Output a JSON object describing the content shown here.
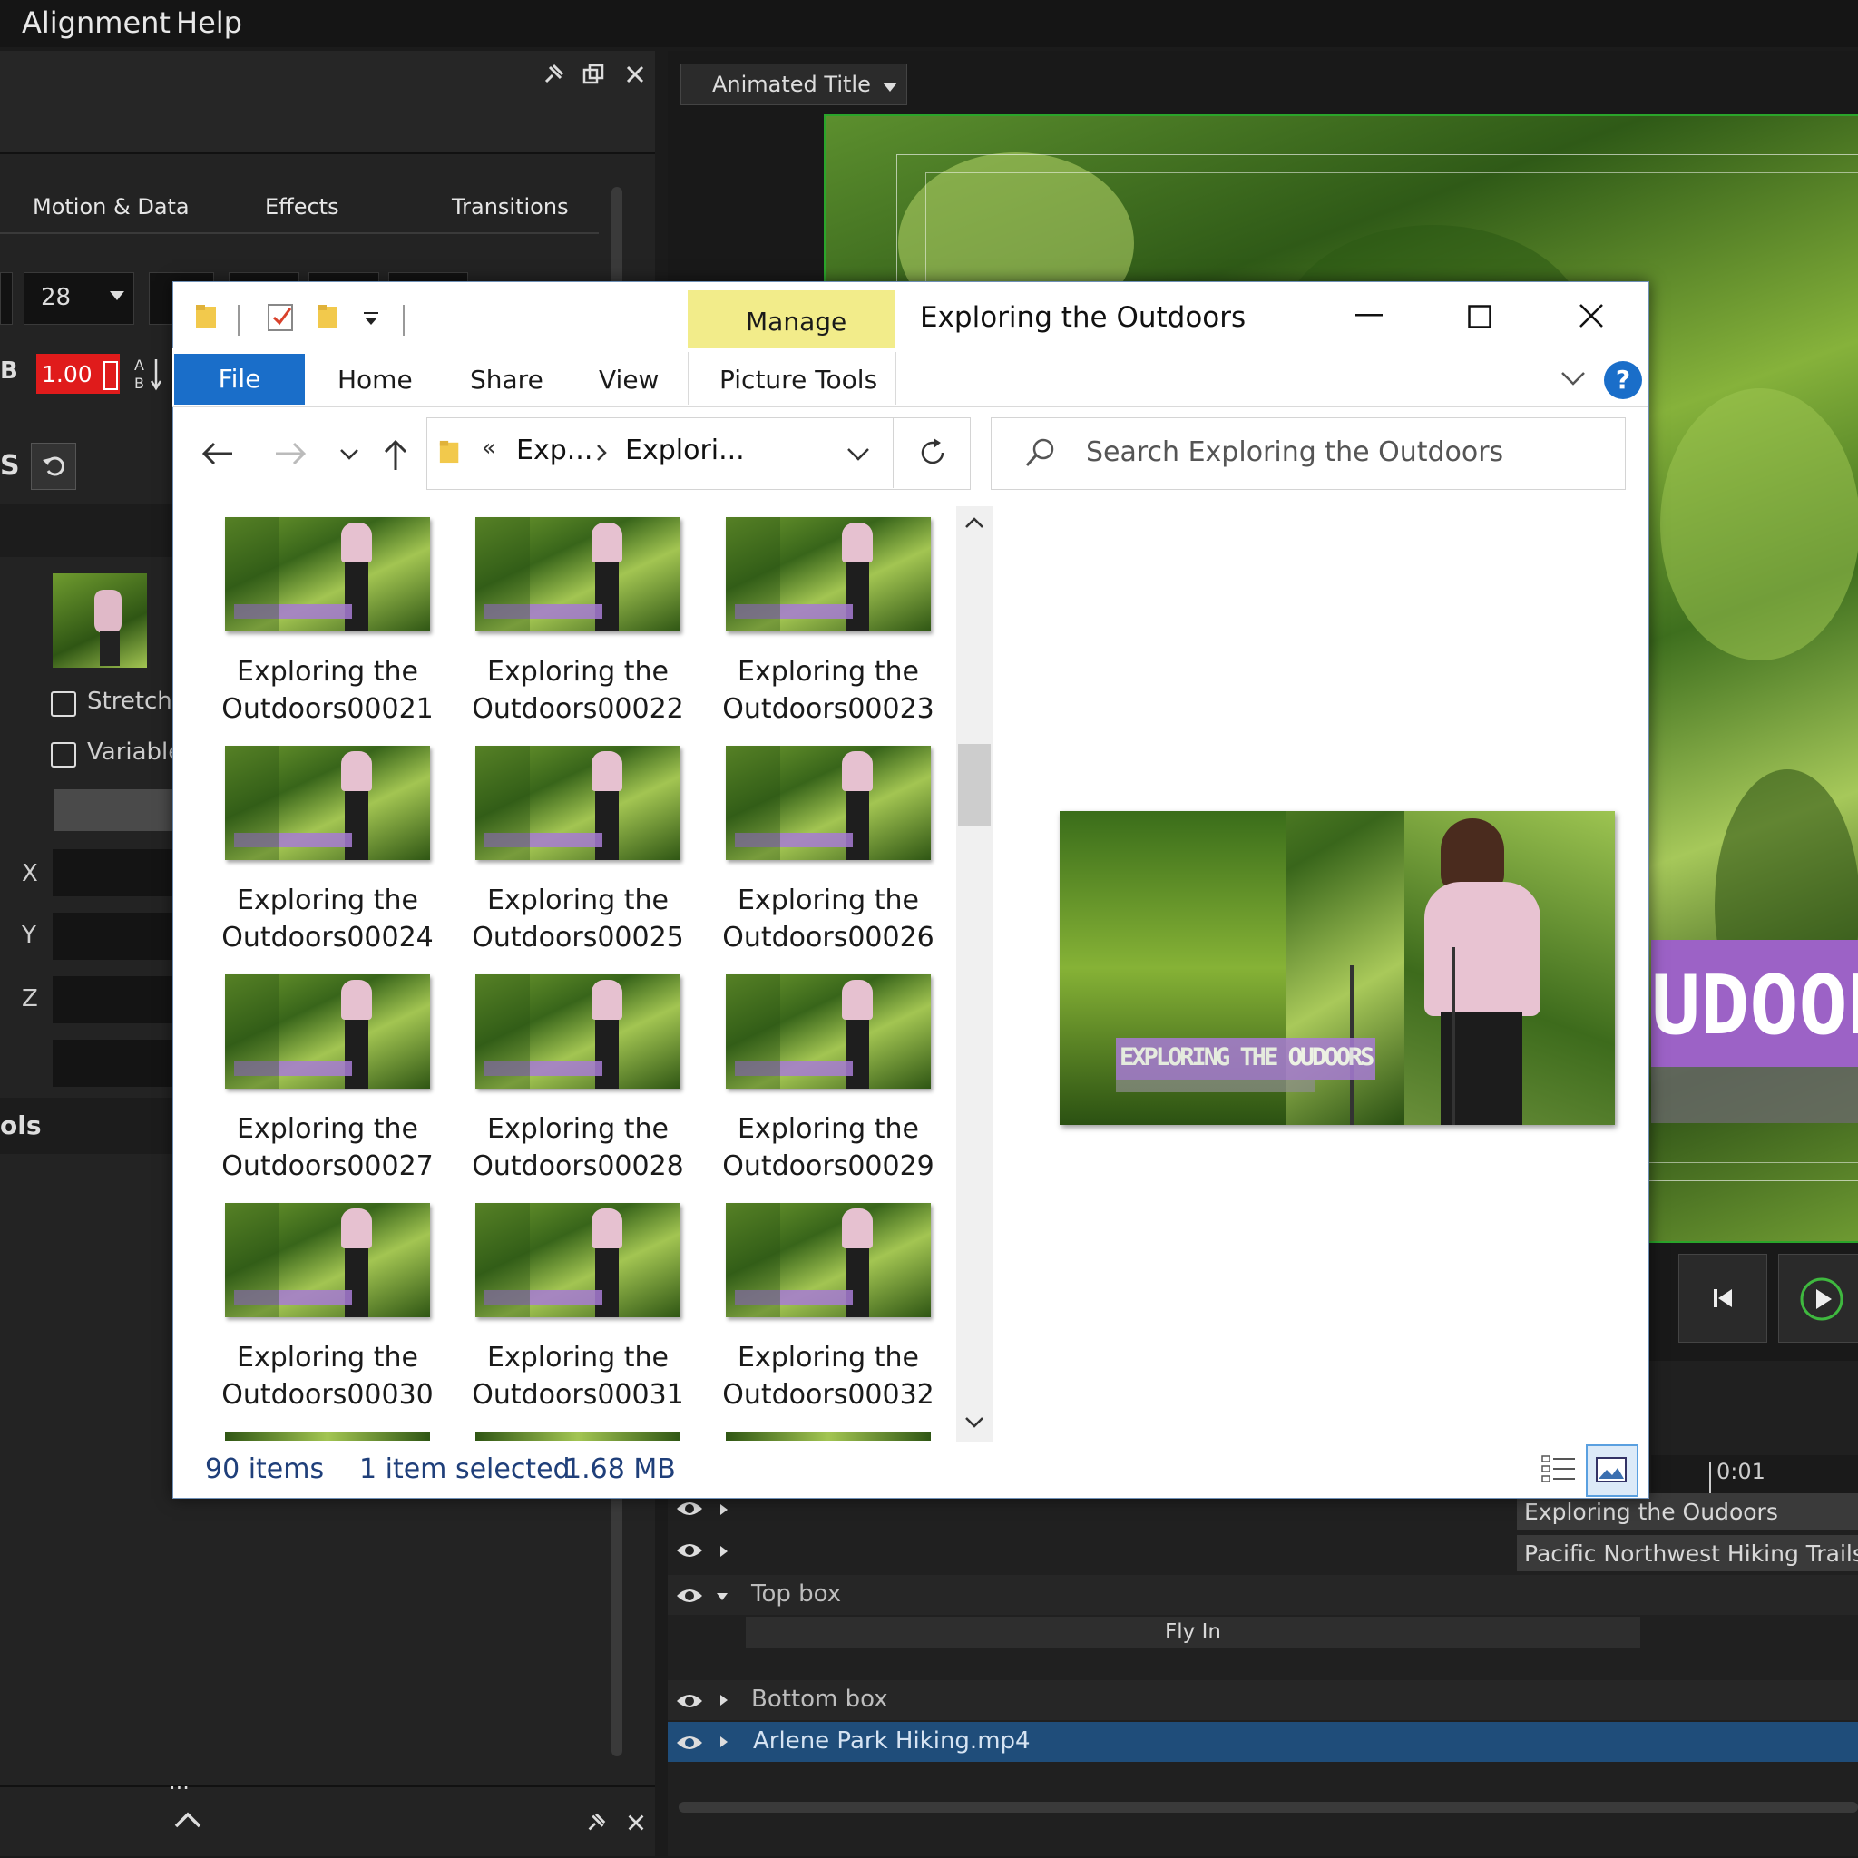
{
  "menubar": {
    "items": [
      "Alignment",
      "Help"
    ]
  },
  "left_panel": {
    "tabs": [
      "Motion & Data",
      "Effects",
      "Transitions"
    ],
    "font_size_value": "28",
    "opacity_value": "1.00",
    "bold_glyph": "B",
    "section_letter": "S",
    "section_tools": "ols",
    "checkboxes": [
      "Stretch",
      "Variable"
    ],
    "axis_labels": [
      "X",
      "Y",
      "Z"
    ]
  },
  "right_panel": {
    "preset_dropdown": "Animated Title",
    "overlay_title": "UDOOR"
  },
  "explorer": {
    "title": "Exploring the Outdoors",
    "contextual_tab": "Manage",
    "ribbon_tabs": [
      "File",
      "Home",
      "Share",
      "View",
      "Picture Tools"
    ],
    "breadcrumb": {
      "prefix": "«",
      "crumbs": [
        "Exp...",
        "Explori..."
      ]
    },
    "search_placeholder": "Search Exploring the Outdoors",
    "files": [
      {
        "line1": "Exploring the",
        "line2": "Outdoors00021"
      },
      {
        "line1": "Exploring the",
        "line2": "Outdoors00022"
      },
      {
        "line1": "Exploring the",
        "line2": "Outdoors00023"
      },
      {
        "line1": "Exploring the",
        "line2": "Outdoors00024"
      },
      {
        "line1": "Exploring the",
        "line2": "Outdoors00025"
      },
      {
        "line1": "Exploring the",
        "line2": "Outdoors00026"
      },
      {
        "line1": "Exploring the",
        "line2": "Outdoors00027"
      },
      {
        "line1": "Exploring the",
        "line2": "Outdoors00028"
      },
      {
        "line1": "Exploring the",
        "line2": "Outdoors00029"
      },
      {
        "line1": "Exploring the",
        "line2": "Outdoors00030"
      },
      {
        "line1": "Exploring the",
        "line2": "Outdoors00031"
      },
      {
        "line1": "Exploring the",
        "line2": "Outdoors00032"
      }
    ],
    "preview_overlay_title": "EXPLORING THE OUDOORS",
    "status": {
      "count": "90 items",
      "selected": "1 item selected",
      "size": "1.68 MB"
    },
    "help_glyph": "?"
  },
  "timeline": {
    "time_marker": "0:01",
    "clips": [
      "Exploring the Oudoors",
      "Pacific Northwest Hiking Trails"
    ],
    "tracks": [
      "Top box",
      "Bottom box",
      "Arlene Park Hiking.mp4"
    ],
    "effect_clip": "Fly In",
    "more_glyph": "..."
  },
  "colors": {
    "accent_blue": "#1a6ec9",
    "manage_yellow": "#f2ec8a",
    "title_purple": "#9c62c6",
    "opacity_red": "#e01b1b",
    "selected_track": "#1f4d7a"
  }
}
